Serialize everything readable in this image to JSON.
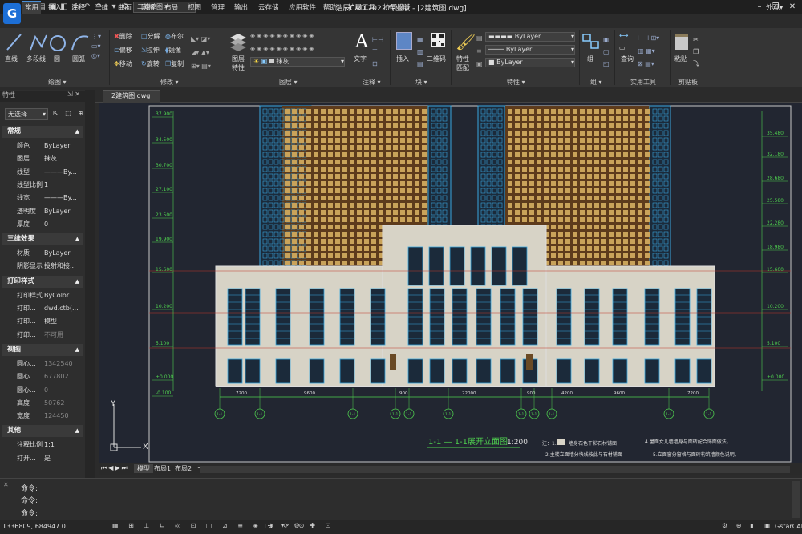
{
  "titlebar": {
    "title": "浩辰CAD 2022 专业版 - [2建筑图.dwg]",
    "workspace": "二维草图",
    "win_min": "–",
    "win_max": "❐",
    "win_close": "✕",
    "logo": "G"
  },
  "menus": [
    "常用",
    "插入",
    "注释",
    "三维",
    "曲面",
    "网格",
    "布局",
    "视图",
    "管理",
    "输出",
    "云存储",
    "应用软件",
    "帮助",
    "扩展工具",
    "协同设计"
  ],
  "menu_right": "外观▾",
  "ribbon": {
    "draw": {
      "line": "直线",
      "polyline": "多段线",
      "circle": "圆",
      "arc": "圆弧",
      "label": "绘图 ▾"
    },
    "modify": {
      "items": [
        "删除",
        "分解",
        "布尔",
        "偏移",
        "拉伸",
        "镜像",
        "移动",
        "旋转",
        "复制"
      ],
      "label": "修改 ▾"
    },
    "layer": {
      "props": "图层特性",
      "current": "抹灰",
      "label": "图层 ▾"
    },
    "annot": {
      "text": "文字",
      "label": "注释 ▾"
    },
    "block": {
      "insert": "插入",
      "qr": "二维码",
      "label": "块 ▾"
    },
    "prop": {
      "match": "特性匹配",
      "bylayer1": "ByLayer",
      "bylayer2": "ByLayer",
      "bylayer3": "ByLayer",
      "label": "特性 ▾"
    },
    "group": {
      "group": "组",
      "label": "组 ▾"
    },
    "util": {
      "query": "查询",
      "label": "实用工具"
    },
    "clip": {
      "paste": "粘贴",
      "label": "剪贴板"
    }
  },
  "doc_tab": "2建筑图.dwg",
  "properties": {
    "title": "特性",
    "selection": "无选择",
    "sections": [
      {
        "name": "常规",
        "rows": [
          [
            "颜色",
            "ByLayer"
          ],
          [
            "图层",
            "抹灰"
          ],
          [
            "线型",
            "———By..."
          ],
          [
            "线型比例",
            "1"
          ],
          [
            "线宽",
            "———By..."
          ],
          [
            "透明度",
            "ByLayer"
          ],
          [
            "厚度",
            "0"
          ]
        ]
      },
      {
        "name": "三维效果",
        "rows": [
          [
            "材质",
            "ByLayer"
          ],
          [
            "阴影显示",
            "投射和接..."
          ]
        ]
      },
      {
        "name": "打印样式",
        "rows": [
          [
            "打印样式",
            "ByColor"
          ],
          [
            "打印...",
            "dwd.ctb(..."
          ],
          [
            "打印...",
            "模型"
          ],
          [
            "打印...",
            "不可用"
          ]
        ]
      },
      {
        "name": "视图",
        "rows": [
          [
            "圆心...",
            "1342540"
          ],
          [
            "圆心...",
            "677802"
          ],
          [
            "圆心...",
            "0"
          ],
          [
            "高度",
            "50762"
          ],
          [
            "宽度",
            "124450"
          ]
        ]
      },
      {
        "name": "其他",
        "rows": [
          [
            "注释比例",
            "1:1"
          ],
          [
            "打开...",
            "是"
          ]
        ]
      }
    ]
  },
  "drawing": {
    "title": "1-1 — 1-1展开立面图",
    "scale": "1:200",
    "notes": [
      "注：1.",
      "墙身石色干粘石材铺面",
      "4.屋面女儿墙墙身与面砖配合饰面做法。",
      "2.主楼立面墙分块线按此与石材铺面",
      "5.立面窗分窗格与面砖构筑墙颜色说明。"
    ],
    "left_elev": [
      "37.900",
      "34.500",
      "30.700",
      "27.100",
      "23.500",
      "19.900",
      "15.600",
      "10.200",
      "5.100",
      "±0.000",
      "-0.100"
    ],
    "right_elev": [
      "35.480",
      "32.180",
      "28.680",
      "25.580",
      "22.280",
      "18.980",
      "15.600",
      "10.200",
      "5.100",
      "±0.000"
    ],
    "dims": [
      "7200",
      "9600",
      "900",
      "22000",
      "900",
      "4200",
      "9600",
      "7200"
    ],
    "axes": [
      "1-1",
      "1-1",
      "1-1",
      "1-1",
      "1-1",
      "1-1",
      "1-1",
      "1-1",
      "1-1",
      "1-1",
      "1-1",
      "1-1",
      "1-1"
    ]
  },
  "layout_tabs": {
    "model": "模型",
    "l1": "布局1",
    "l2": "布局2"
  },
  "command": {
    "lines": [
      "命令:",
      "命令:",
      "命令:"
    ]
  },
  "status": {
    "coords": "1336809, 684947.0",
    "scale": "1:1",
    "app": "GstarCAD"
  }
}
